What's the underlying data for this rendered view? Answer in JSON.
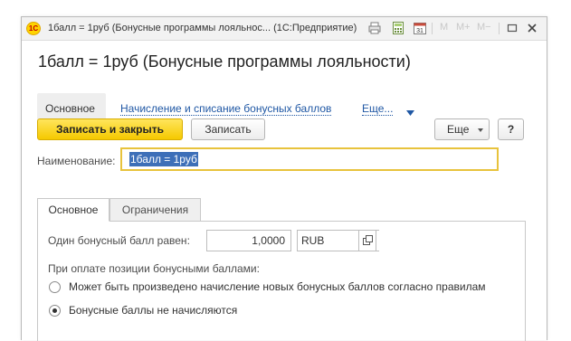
{
  "window": {
    "title": "1балл = 1руб (Бонусные программы лояльнос... (1С:Предприятие)",
    "logo": "1С",
    "tools": {
      "m": "M",
      "m_plus": "M+",
      "m_minus": "M−"
    },
    "icons": [
      "print-icon",
      "calculator-icon",
      "calendar-icon",
      "restore-icon",
      "close-icon"
    ],
    "calendar_day": "31"
  },
  "form": {
    "title": "1балл = 1руб (Бонусные программы лояльности)"
  },
  "navbar": {
    "main_label": "Основное",
    "link_label": "Начисление и списание бонусных баллов",
    "more_label": "Еще..."
  },
  "toolbar": {
    "save_close_label": "Записать и закрыть",
    "save_label": "Записать",
    "more_label": "Еще",
    "help_label": "?"
  },
  "fields": {
    "name_label": "Наименование:",
    "name_value": "1балл = 1руб"
  },
  "tabs": [
    {
      "label": "Основное",
      "active": true
    },
    {
      "label": "Ограничения",
      "active": false
    }
  ],
  "main_tab": {
    "rate_label": "Один бонусный балл равен:",
    "rate_value": "1,0000",
    "currency_value": "RUB",
    "payment_label": "При оплате позиции бонусными баллами:",
    "options": [
      {
        "label": "Может быть произведено начисление новых бонусных баллов согласно правилам",
        "selected": false
      },
      {
        "label": "Бонусные баллы не начисляются",
        "selected": true
      }
    ]
  },
  "colors": {
    "accent_yellow": "#f5c900",
    "link_blue": "#1f57a4",
    "focus_border": "#e8c33c",
    "selection_bg": "#3d6fb8"
  }
}
